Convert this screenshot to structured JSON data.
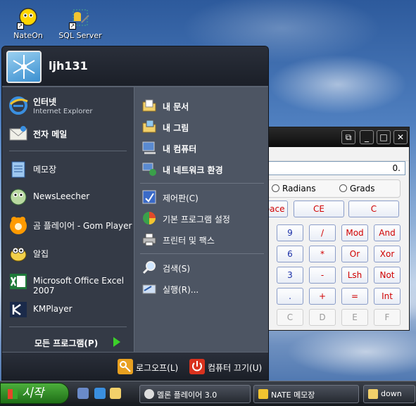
{
  "desktop": {
    "icons": [
      {
        "label": "NateOn",
        "icon": "nateon-icon"
      },
      {
        "label": "SQL Server",
        "icon": "sql-server-icon"
      }
    ]
  },
  "calculator": {
    "display_value": "0.",
    "radios": [
      "Radians",
      "Grads"
    ],
    "keys_row1": [
      "pace",
      "CE",
      "C"
    ],
    "keys_row2": [
      "9",
      "/",
      "Mod",
      "And"
    ],
    "keys_row3": [
      "6",
      "*",
      "Or",
      "Xor"
    ],
    "keys_row4": [
      "3",
      "-",
      "Lsh",
      "Not"
    ],
    "keys_row5": [
      ".",
      "+",
      "=",
      "Int"
    ],
    "keys_row6": [
      "C",
      "D",
      "E",
      "F"
    ]
  },
  "start_menu": {
    "user_name": "ljh131",
    "pinned": [
      {
        "label": "인터넷",
        "sub": "Internet Explorer",
        "icon": "internet-explorer-icon"
      },
      {
        "label": "전자 메일",
        "icon": "email-icon"
      }
    ],
    "recent": [
      {
        "label": "메모장",
        "icon": "notepad-icon"
      },
      {
        "label": "NewsLeecher",
        "icon": "newsleecher-icon"
      },
      {
        "label": "곰 플레이어 - Gom Player",
        "icon": "gom-player-icon"
      },
      {
        "label": "알집",
        "icon": "alzip-icon"
      },
      {
        "label": "Microsoft Office Excel 2007",
        "icon": "excel-icon"
      },
      {
        "label": "KMPlayer",
        "icon": "kmplayer-icon"
      }
    ],
    "all_programs": "모든 프로그램(P)",
    "right_top": [
      {
        "label": "내 문서",
        "icon": "my-documents-icon"
      },
      {
        "label": "내 그림",
        "icon": "my-pictures-icon"
      },
      {
        "label": "내 컴퓨터",
        "icon": "my-computer-icon"
      },
      {
        "label": "내 네트워크 환경",
        "icon": "my-network-icon"
      }
    ],
    "right_mid": [
      {
        "label": "제어판(C)",
        "icon": "control-panel-icon"
      },
      {
        "label": "기본 프로그램 설정",
        "icon": "default-programs-icon"
      },
      {
        "label": "프린터 및 팩스",
        "icon": "printer-icon"
      }
    ],
    "right_bottom": [
      {
        "label": "검색(S)",
        "icon": "search-icon"
      },
      {
        "label": "실행(R)...",
        "icon": "run-icon"
      }
    ],
    "logoff": "로그오프(L)",
    "shutdown": "컴퓨터 끄기(U)"
  },
  "taskbar": {
    "start_label": "시작",
    "tasks": [
      {
        "label": "멜론 플레이어 3.0",
        "icon": "melon-player-icon"
      },
      {
        "label": "NATE 메모장",
        "icon": "nate-memo-icon"
      },
      {
        "label": "down",
        "icon": "folder-icon"
      }
    ]
  }
}
